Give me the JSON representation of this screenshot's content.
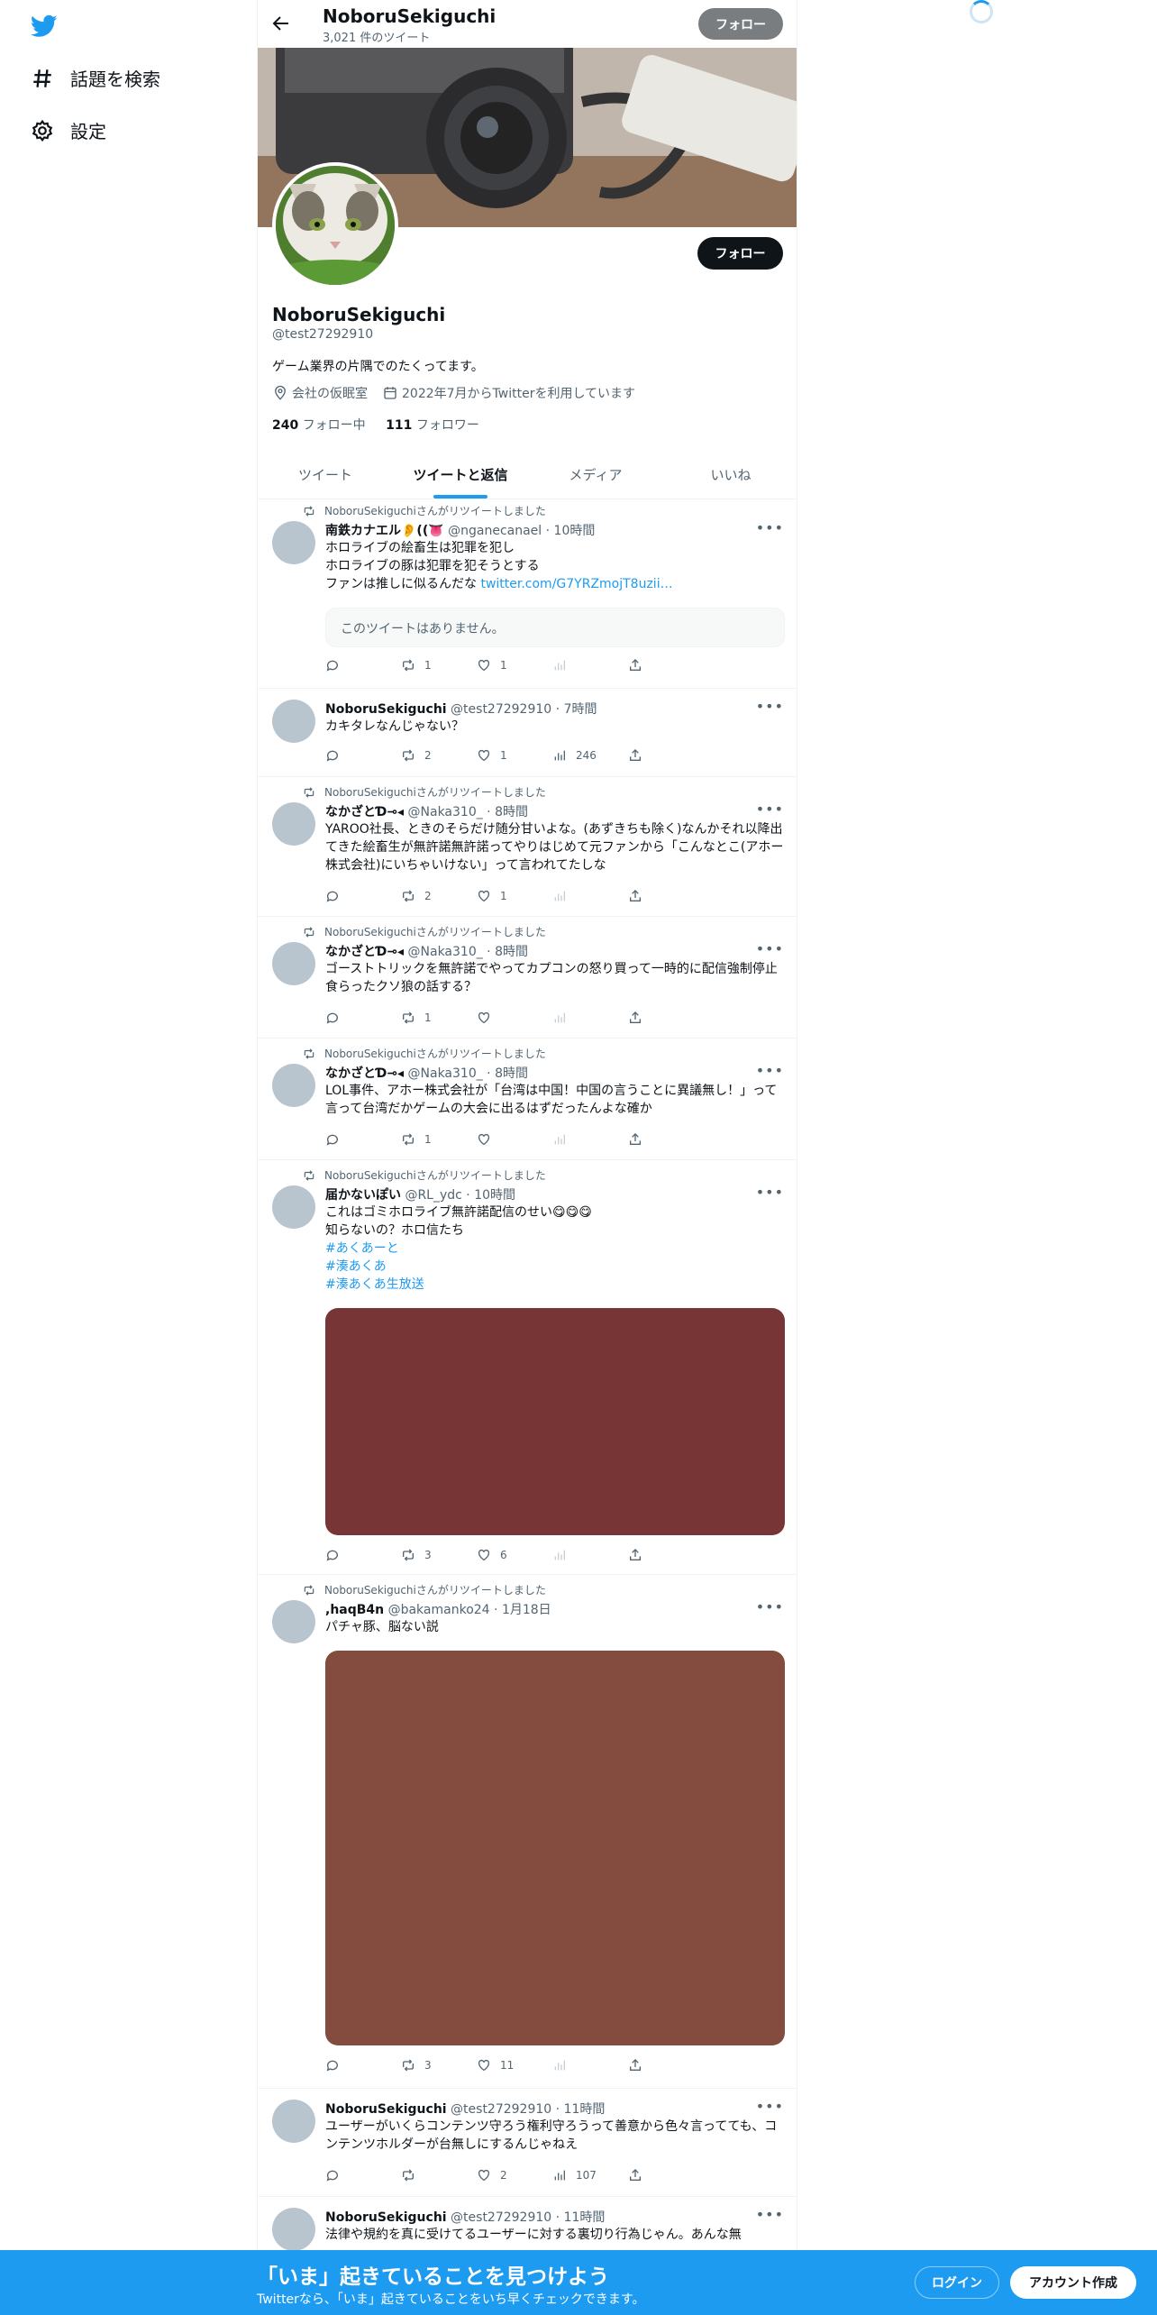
{
  "nav": {
    "explore_label": "話題を検索",
    "settings_label": "設定"
  },
  "profile": {
    "name": "NoboruSekiguchi",
    "tweet_count": "3,021 件のツイート",
    "follow_label": "フォロー",
    "handle": "@test27292910",
    "bio": "ゲーム業界の片隅でのたくってます。",
    "location": "会社の仮眠室",
    "joined": "2022年7月からTwitterを利用しています",
    "following_count": "240",
    "following_label": "フォロー中",
    "followers_count": "111",
    "followers_label": "フォロワー"
  },
  "tabs": [
    "ツイート",
    "ツイートと返信",
    "メディア",
    "いいね"
  ],
  "active_tab": "ツイートと返信",
  "tweets": [
    {
      "retweeted_by": "NoboruSekiguchiさんがリツイートしました",
      "name": "南鉄カナエル👂((👅",
      "handle": "@nganecanael",
      "time": "10時間",
      "text": "ホロライブの絵畜生は犯罪を犯し\nホロライブの豚は犯罪を犯そうとする\nファンは推しに似るんだな ",
      "link": "twitter.com/G7YRZmojT8uzii…",
      "quote": "このツイートはありません。",
      "replies": "",
      "retweets": "1",
      "likes": "1",
      "views": ""
    },
    {
      "retweeted_by": "",
      "name": "NoboruSekiguchi",
      "handle": "@test27292910",
      "time": "7時間",
      "text": "カキタレなんじゃない？",
      "replies": "",
      "retweets": "2",
      "likes": "1",
      "views": "246"
    },
    {
      "retweeted_by": "NoboruSekiguchiさんがリツイートしました",
      "name": "なかざとƊ⊸◂",
      "handle": "@Naka310_",
      "time": "8時間",
      "text": "YAROO社長、ときのそらだけ随分甘いよな。(あずきちも除く)なんかそれ以降出てきた絵畜生が無許諾無許諾ってやりはじめて元ファンから「こんなとこ(アホー株式会社)にいちゃいけない」って言われてたしな",
      "replies": "",
      "retweets": "2",
      "likes": "1",
      "views": ""
    },
    {
      "retweeted_by": "NoboruSekiguchiさんがリツイートしました",
      "name": "なかざとƊ⊸◂",
      "handle": "@Naka310_",
      "time": "8時間",
      "text": "ゴーストトリックを無許諾でやってカプコンの怒り買って一時的に配信強制停止食らったクソ狼の話する？",
      "replies": "",
      "retweets": "1",
      "likes": "",
      "views": ""
    },
    {
      "retweeted_by": "NoboruSekiguchiさんがリツイートしました",
      "name": "なかざとƊ⊸◂",
      "handle": "@Naka310_",
      "time": "8時間",
      "text": "LOL事件、アホー株式会社が「台湾は中国！中国の言うことに異議無し！」って言って台湾だかゲームの大会に出るはずだったんよな確か",
      "replies": "",
      "retweets": "1",
      "likes": "",
      "views": ""
    },
    {
      "retweeted_by": "NoboruSekiguchiさんがリツイートしました",
      "name": "届かないぽい",
      "handle": "@RL_ydc",
      "time": "10時間",
      "text": "これはゴミホロライブ無許諾配信のせい😋😋😋\n知らないの？ホロ信たち",
      "hashtags": [
        "#あくあーと",
        "#湊あくあ",
        "#湊あくあ生放送"
      ],
      "media_color": "#783536",
      "replies": "",
      "retweets": "3",
      "likes": "6",
      "views": ""
    },
    {
      "retweeted_by": "NoboruSekiguchiさんがリツイートしました",
      "name": ",haqB4n",
      "handle": "@bakamanko24",
      "time": "1月18日",
      "text": "パチャ豚、脳ない説",
      "media_color": "#844c3e",
      "replies": "",
      "retweets": "3",
      "likes": "11",
      "views": ""
    },
    {
      "retweeted_by": "",
      "name": "NoboruSekiguchi",
      "handle": "@test27292910",
      "time": "11時間",
      "text": "ユーザーがいくらコンテンツ守ろう権利守ろうって善意から色々言ってても、コンテンツホルダーが台無しにするんじゃねえ",
      "replies": "",
      "retweets": "",
      "likes": "2",
      "views": "107"
    },
    {
      "retweeted_by": "",
      "name": "NoboruSekiguchi",
      "handle": "@test27292910",
      "time": "11時間",
      "text": "法律や規約を真に受けてるユーザーに対する裏切り行為じゃん。あんな無"
    }
  ],
  "signup_bar": {
    "title": "「いま」起きていることを見つけよう",
    "subtitle": "Twitterなら、「いま」起きていることをいち早くチェックできます。",
    "login_label": "ログイン",
    "signup_label": "アカウント作成"
  },
  "colors": {
    "accent": "#1d9bf0",
    "text": "#0f1419",
    "muted": "#536471"
  }
}
